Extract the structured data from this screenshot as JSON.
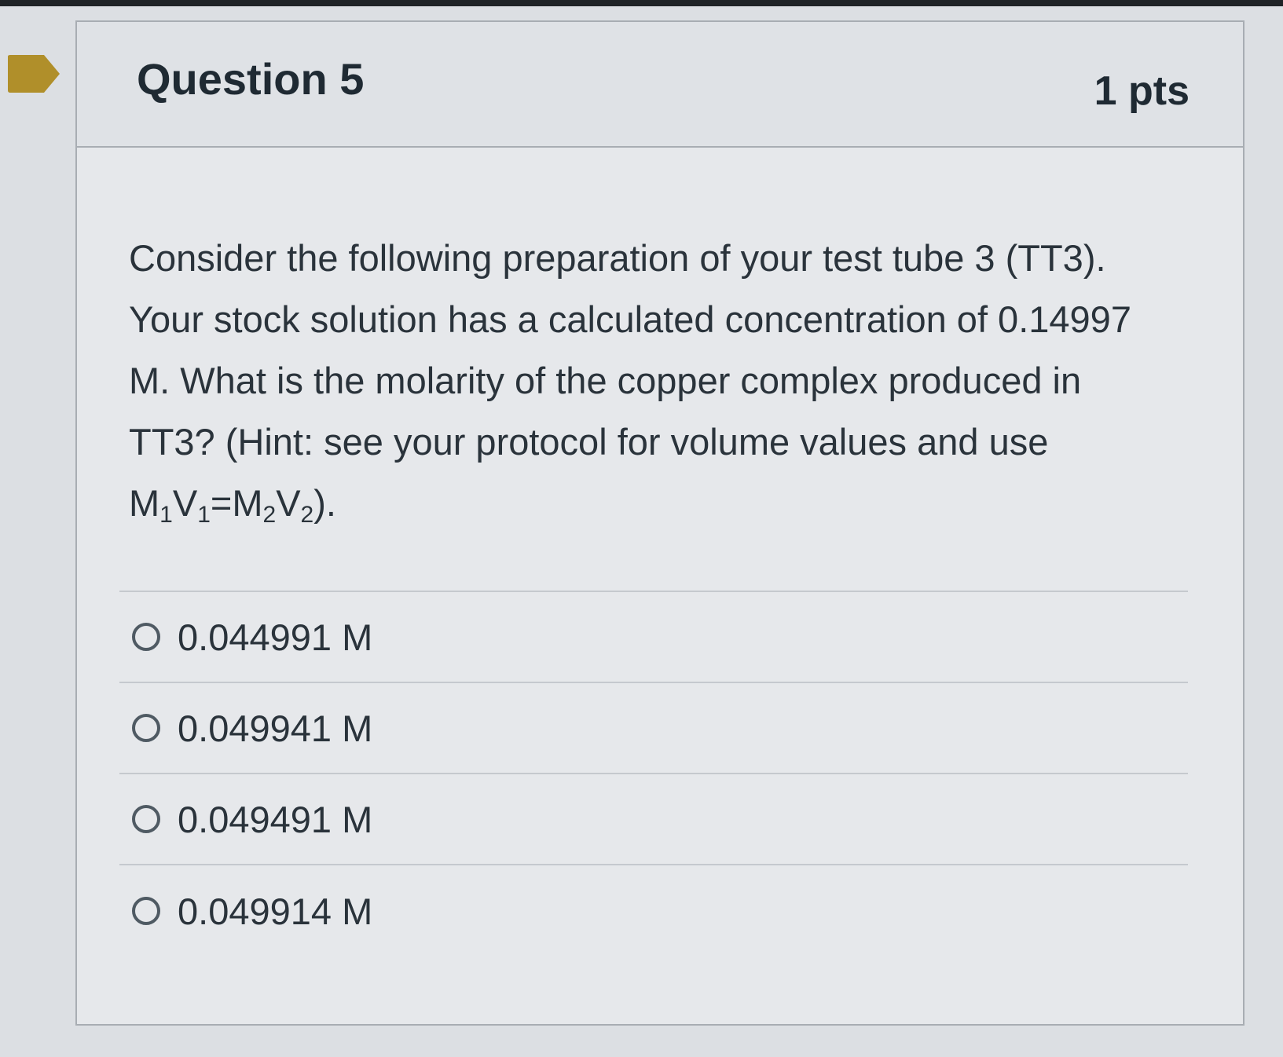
{
  "question": {
    "title": "Question 5",
    "points": "1 pts",
    "text": {
      "main": "Consider the following preparation of your test tube 3 (TT3). Your stock solution has a calculated concentration of 0.14997 M. What is the molarity of the copper complex produced in TT3? (Hint: see your protocol for volume values and use ",
      "f1": "M",
      "s1": "1",
      "f2": "V",
      "s2": "1",
      "f3": "=M",
      "s3": "2",
      "f4": "V",
      "s4": "2",
      "end": ")."
    }
  },
  "answers": [
    {
      "label": "0.044991 M",
      "selected": false
    },
    {
      "label": "0.049941 M",
      "selected": false
    },
    {
      "label": "0.049491 M",
      "selected": false
    },
    {
      "label": "0.049914 M",
      "selected": false
    }
  ],
  "colors": {
    "flag": "#b08f2a",
    "card_border": "#a8adb3",
    "text": "#2a333b"
  },
  "icons": {
    "flag": "flag-marker-icon",
    "radio": "radio-unselected-icon"
  }
}
